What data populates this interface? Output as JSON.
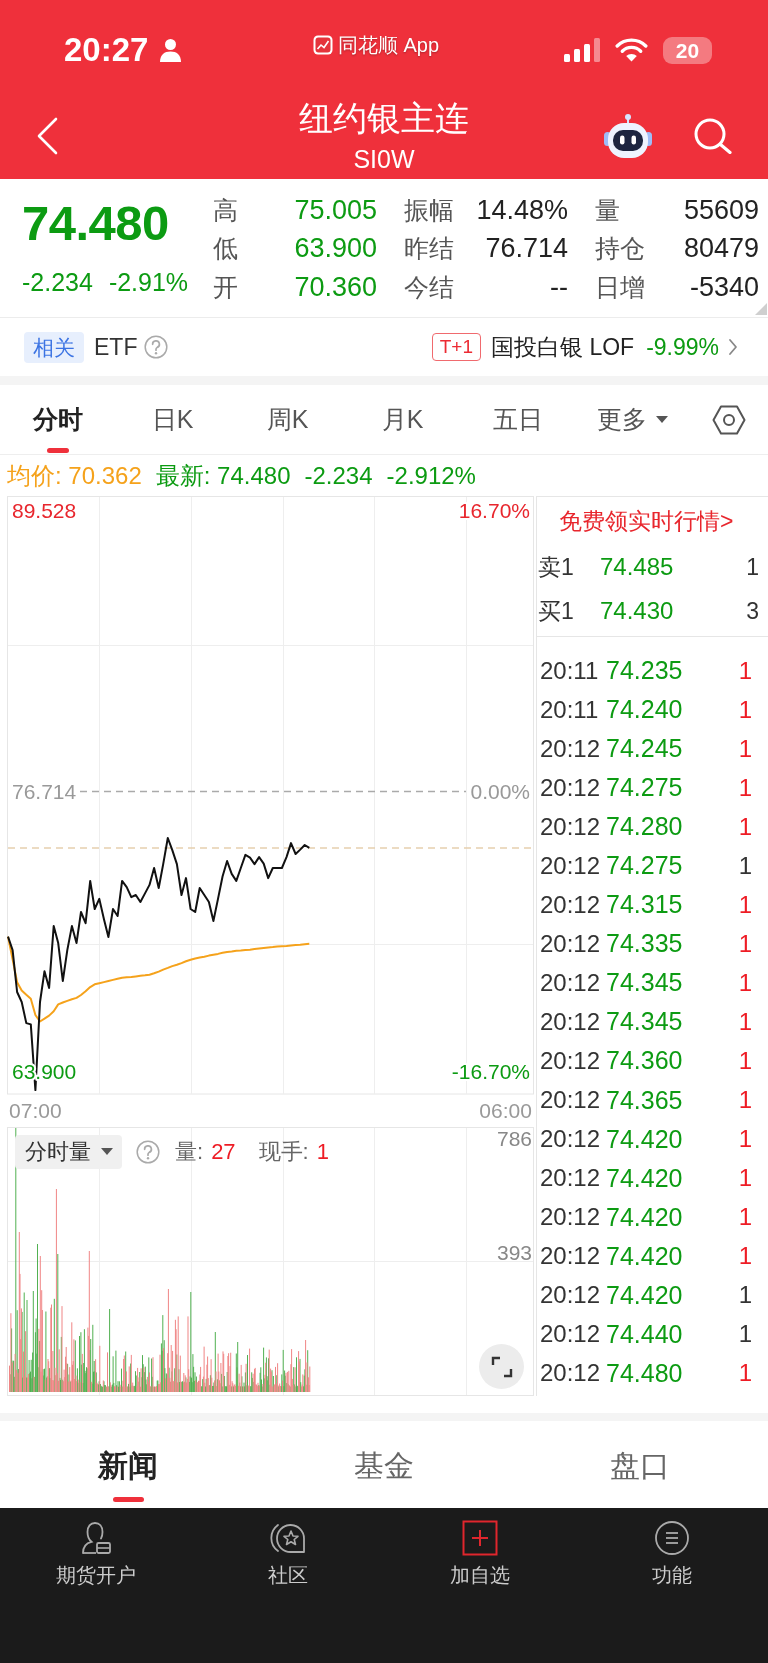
{
  "status_bar": {
    "time": "20:27",
    "app": "同花顺 App",
    "battery": "20"
  },
  "nav": {
    "title": "纽约银主连",
    "code": "SI0W"
  },
  "quote": {
    "price": "74.480",
    "change": "-2.234",
    "change_pct": "-2.91%",
    "falling": true,
    "stats": [
      {
        "label": "高",
        "value": "75.005",
        "color": "#0c9b12"
      },
      {
        "label": "振幅",
        "value": "14.48%",
        "color": "#222222"
      },
      {
        "label": "量",
        "value": "55609",
        "color": "#222222"
      },
      {
        "label": "低",
        "value": "63.900",
        "color": "#0c9b12"
      },
      {
        "label": "昨结",
        "value": "76.714",
        "color": "#222222"
      },
      {
        "label": "持仓",
        "value": "80479",
        "color": "#222222"
      },
      {
        "label": "开",
        "value": "70.360",
        "color": "#0c9b12"
      },
      {
        "label": "今结",
        "value": "--",
        "color": "#222222"
      },
      {
        "label": "日增",
        "value": "-5340",
        "color": "#222222"
      }
    ]
  },
  "related": {
    "tag": "相关",
    "label": "ETF",
    "fund_tag": "T+1",
    "fund_name": "国投白银 LOF",
    "fund_change": "-9.99%",
    "falling": true
  },
  "tabs": [
    {
      "label": "分时",
      "selected": true,
      "kind": "tab"
    },
    {
      "label": "日K",
      "selected": false,
      "kind": "tab"
    },
    {
      "label": "周K",
      "selected": false,
      "kind": "tab"
    },
    {
      "label": "月K",
      "selected": false,
      "kind": "tab"
    },
    {
      "label": "五日",
      "selected": false,
      "kind": "tab"
    },
    {
      "label": "更多",
      "selected": false,
      "kind": "dropdown"
    }
  ],
  "chart_info": {
    "average": "均价: 70.362",
    "latest": "最新: 74.480",
    "change": "-2.234",
    "change_pct": "-2.912%",
    "falling": true
  },
  "price_chart": {
    "change_labels": [
      "16.70%",
      "0.00%",
      "-16.70%"
    ],
    "chart_data": {
      "type": "line",
      "categories": [
        null,
        null,
        null,
        null,
        null,
        null,
        "07:00",
        null,
        null,
        null,
        null,
        null,
        null,
        null,
        null,
        null,
        null,
        null,
        null,
        null,
        null,
        null,
        null,
        null,
        null,
        null,
        null,
        null,
        null,
        null,
        null,
        null,
        null,
        null,
        null,
        null,
        null,
        null,
        null,
        null,
        null,
        null,
        null,
        null,
        null,
        null,
        null,
        null,
        null,
        null,
        null,
        null,
        null,
        null,
        null,
        null,
        null,
        null,
        null,
        null,
        null,
        null,
        null,
        null,
        null,
        null,
        null,
        null,
        null,
        null,
        null,
        null,
        null,
        null,
        null,
        null,
        null,
        null,
        null,
        null,
        null,
        null,
        null,
        null,
        null,
        null,
        null,
        null,
        null,
        null,
        null,
        null,
        null,
        null,
        null,
        null,
        null,
        null,
        null,
        null,
        null,
        null,
        null,
        null,
        null,
        null,
        null,
        null,
        null,
        "06:00",
        null,
        null,
        null,
        null,
        null,
        null
      ],
      "series": [
        {
          "color": "#111111",
          "values": [
            70.09,
            69.47,
            67.56,
            67.1,
            66.14,
            66.08,
            63.08,
            67.1,
            68.51,
            67.74,
            70.57,
            69.79,
            68.06,
            69.47,
            70.57,
            69.79,
            71.21,
            70.7,
            72.63,
            71.35,
            71.81,
            70.89,
            70.07,
            71.35,
            71.03,
            72.63,
            72.35,
            71.89,
            71.99,
            71.67,
            72.06,
            72.45,
            73.22,
            72.31,
            73.4,
            74.59,
            74.04,
            73.4,
            71.99,
            72.76,
            71.35,
            71.21,
            72.31,
            71.99,
            71.67,
            70.8,
            71.81,
            72.84,
            73.54,
            72.95,
            72.63,
            73.22,
            73.82,
            73.69,
            73.4,
            73.72,
            73.42,
            72.76,
            73.22,
            73.22,
            73.22,
            73.72,
            74.36,
            73.86,
            74.06,
            74.27,
            74.14,
            null,
            null,
            null,
            null,
            null,
            null,
            null,
            null,
            null,
            null,
            null,
            null,
            null,
            null,
            null,
            null,
            null,
            null,
            null,
            null,
            null,
            null,
            null,
            null,
            null,
            null,
            null,
            null,
            null,
            null,
            null,
            null,
            null,
            null,
            null,
            null,
            null,
            null,
            null,
            null,
            null,
            null,
            null,
            null,
            null,
            null,
            null,
            null,
            null
          ]
        },
        {
          "color": "#f5a21b",
          "values": [
            70.09,
            69.05,
            68.0,
            67.62,
            67.43,
            67.25,
            66.51,
            66.21,
            66.34,
            66.48,
            66.68,
            66.99,
            67.08,
            67.15,
            67.23,
            67.29,
            67.42,
            67.59,
            67.78,
            67.91,
            67.96,
            68.01,
            68.06,
            68.11,
            68.16,
            68.21,
            68.23,
            68.25,
            68.27,
            68.3,
            68.32,
            68.35,
            68.41,
            68.49,
            68.58,
            68.66,
            68.74,
            68.8,
            68.88,
            68.96,
            69.03,
            69.09,
            69.13,
            69.17,
            69.22,
            69.26,
            69.3,
            69.35,
            69.39,
            69.41,
            69.44,
            69.45,
            69.47,
            69.49,
            69.52,
            69.55,
            69.57,
            69.59,
            69.61,
            69.63,
            69.65,
            69.66,
            69.68,
            69.7,
            69.72,
            69.74,
            69.76,
            null,
            null,
            null,
            null,
            null,
            null,
            null,
            null,
            null,
            null,
            null,
            null,
            null,
            null,
            null,
            null,
            null,
            null,
            null,
            null,
            null,
            null,
            null,
            null,
            null,
            null,
            null,
            null,
            null,
            null,
            null,
            null,
            null,
            null,
            null,
            null,
            null,
            null,
            null,
            null,
            null,
            null,
            null,
            null,
            null,
            null,
            null,
            null,
            null
          ]
        }
      ],
      "ylim": [
        62.9,
        90.21
      ],
      "yticks": [
        {
          "value": 89.528,
          "label": "89.528"
        },
        {
          "value": 76.714,
          "label": "76.714"
        },
        {
          "value": 63.9,
          "label": "63.900"
        }
      ],
      "ref_lines": [
        {
          "axis": "y",
          "value": 76.714,
          "color": "#aaaaaa"
        },
        {
          "axis": "y",
          "value": 74.14,
          "color": "#e6cfae"
        }
      ]
    }
  },
  "volume_chart": {
    "selector": "分时量",
    "volume_label": "量:",
    "volume": "27",
    "hand_label": "现手:",
    "hand": "1",
    "axis_labels": [
      "786",
      "393"
    ]
  },
  "order_book": {
    "promo": "免费领实时行情>",
    "falling": true,
    "levels": [
      {
        "label": "卖1",
        "price": "74.485",
        "qty": "1"
      },
      {
        "label": "买1",
        "price": "74.430",
        "qty": "3"
      }
    ],
    "trades": [
      {
        "time": "20:11",
        "price": "74.235",
        "qty": "1",
        "color": "#ee1c25"
      },
      {
        "time": "20:11",
        "price": "74.240",
        "qty": "1",
        "color": "#ee1c25"
      },
      {
        "time": "20:12",
        "price": "74.245",
        "qty": "1",
        "color": "#ee1c25"
      },
      {
        "time": "20:12",
        "price": "74.275",
        "qty": "1",
        "color": "#ee1c25"
      },
      {
        "time": "20:12",
        "price": "74.280",
        "qty": "1",
        "color": "#ee1c25"
      },
      {
        "time": "20:12",
        "price": "74.275",
        "qty": "1",
        "color": "#333333"
      },
      {
        "time": "20:12",
        "price": "74.315",
        "qty": "1",
        "color": "#ee1c25"
      },
      {
        "time": "20:12",
        "price": "74.335",
        "qty": "1",
        "color": "#ee1c25"
      },
      {
        "time": "20:12",
        "price": "74.345",
        "qty": "1",
        "color": "#ee1c25"
      },
      {
        "time": "20:12",
        "price": "74.345",
        "qty": "1",
        "color": "#ee1c25"
      },
      {
        "time": "20:12",
        "price": "74.360",
        "qty": "1",
        "color": "#ee1c25"
      },
      {
        "time": "20:12",
        "price": "74.365",
        "qty": "1",
        "color": "#ee1c25"
      },
      {
        "time": "20:12",
        "price": "74.420",
        "qty": "1",
        "color": "#ee1c25"
      },
      {
        "time": "20:12",
        "price": "74.420",
        "qty": "1",
        "color": "#ee1c25"
      },
      {
        "time": "20:12",
        "price": "74.420",
        "qty": "1",
        "color": "#ee1c25"
      },
      {
        "time": "20:12",
        "price": "74.420",
        "qty": "1",
        "color": "#ee1c25"
      },
      {
        "time": "20:12",
        "price": "74.420",
        "qty": "1",
        "color": "#333333"
      },
      {
        "time": "20:12",
        "price": "74.440",
        "qty": "1",
        "color": "#333333"
      },
      {
        "time": "20:12",
        "price": "74.480",
        "qty": "1",
        "color": "#ee1c25"
      }
    ]
  },
  "bottom_tabs": [
    {
      "label": "新闻",
      "selected": true
    },
    {
      "label": "基金",
      "selected": false
    },
    {
      "label": "盘口",
      "selected": false
    }
  ],
  "tab_bar": [
    {
      "label": "期货开户",
      "kind": "account"
    },
    {
      "label": "社区",
      "kind": "community"
    },
    {
      "label": "加自选",
      "kind": "add"
    },
    {
      "label": "功能",
      "kind": "menu"
    }
  ]
}
